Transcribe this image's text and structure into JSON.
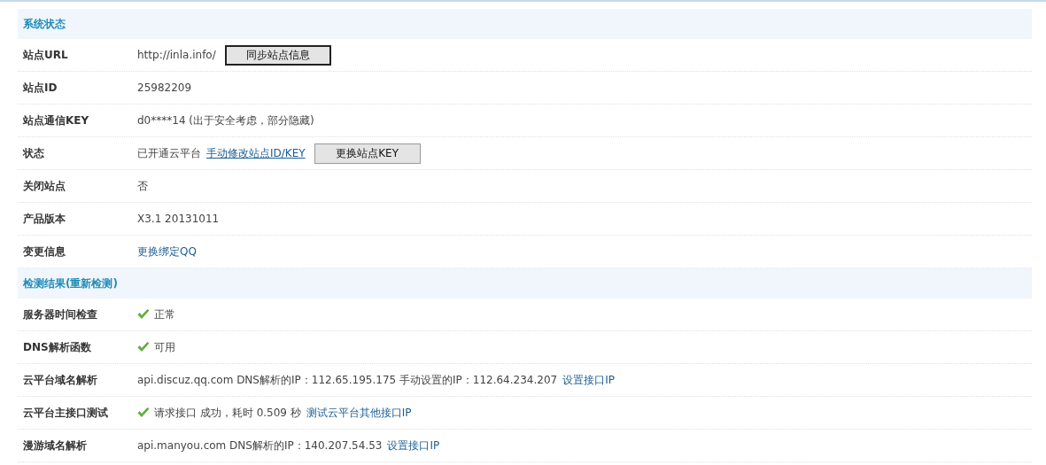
{
  "sections": [
    {
      "title": "系统状态",
      "rows": [
        {
          "label": "站点URL",
          "parts": [
            {
              "kind": "text",
              "text": "http://inla.info/"
            },
            {
              "kind": "button",
              "text": "同步站点信息",
              "focused": true
            }
          ]
        },
        {
          "label": "站点ID",
          "parts": [
            {
              "kind": "text",
              "text": "25982209"
            }
          ]
        },
        {
          "label": "站点通信KEY",
          "parts": [
            {
              "kind": "text",
              "text": "d0****14 (出于安全考虑，部分隐藏)"
            }
          ]
        },
        {
          "label": "状态",
          "parts": [
            {
              "kind": "text",
              "text": "已开通云平台"
            },
            {
              "kind": "link",
              "text": "手动修改站点ID/KEY",
              "underline": true
            },
            {
              "kind": "button",
              "text": "更换站点KEY",
              "focused": false
            }
          ]
        },
        {
          "label": "关闭站点",
          "parts": [
            {
              "kind": "text",
              "text": "否"
            }
          ]
        },
        {
          "label": "产品版本",
          "parts": [
            {
              "kind": "text",
              "text": "X3.1 20131011"
            }
          ]
        },
        {
          "label": "变更信息",
          "parts": [
            {
              "kind": "link",
              "text": "更换绑定QQ",
              "underline": false
            }
          ]
        }
      ]
    },
    {
      "title": "检测结果(重新检测)",
      "rows": [
        {
          "label": "服务器时间检查",
          "parts": [
            {
              "kind": "check",
              "text": "正常"
            }
          ]
        },
        {
          "label": "DNS解析函数",
          "parts": [
            {
              "kind": "check",
              "text": "可用"
            }
          ]
        },
        {
          "label": "云平台域名解析",
          "parts": [
            {
              "kind": "text",
              "text": "api.discuz.qq.com DNS解析的IP：112.65.195.175 手动设置的IP：112.64.234.207"
            },
            {
              "kind": "link",
              "text": "设置接口IP",
              "underline": false
            }
          ]
        },
        {
          "label": "云平台主接口测试",
          "parts": [
            {
              "kind": "check",
              "text": "请求接口 成功，耗时 0.509 秒"
            },
            {
              "kind": "link",
              "text": "测试云平台其他接口IP",
              "underline": false
            }
          ]
        },
        {
          "label": "漫游域名解析",
          "parts": [
            {
              "kind": "text",
              "text": "api.manyou.com DNS解析的IP：140.207.54.53"
            },
            {
              "kind": "link",
              "text": "设置接口IP",
              "underline": false
            }
          ]
        }
      ]
    }
  ]
}
